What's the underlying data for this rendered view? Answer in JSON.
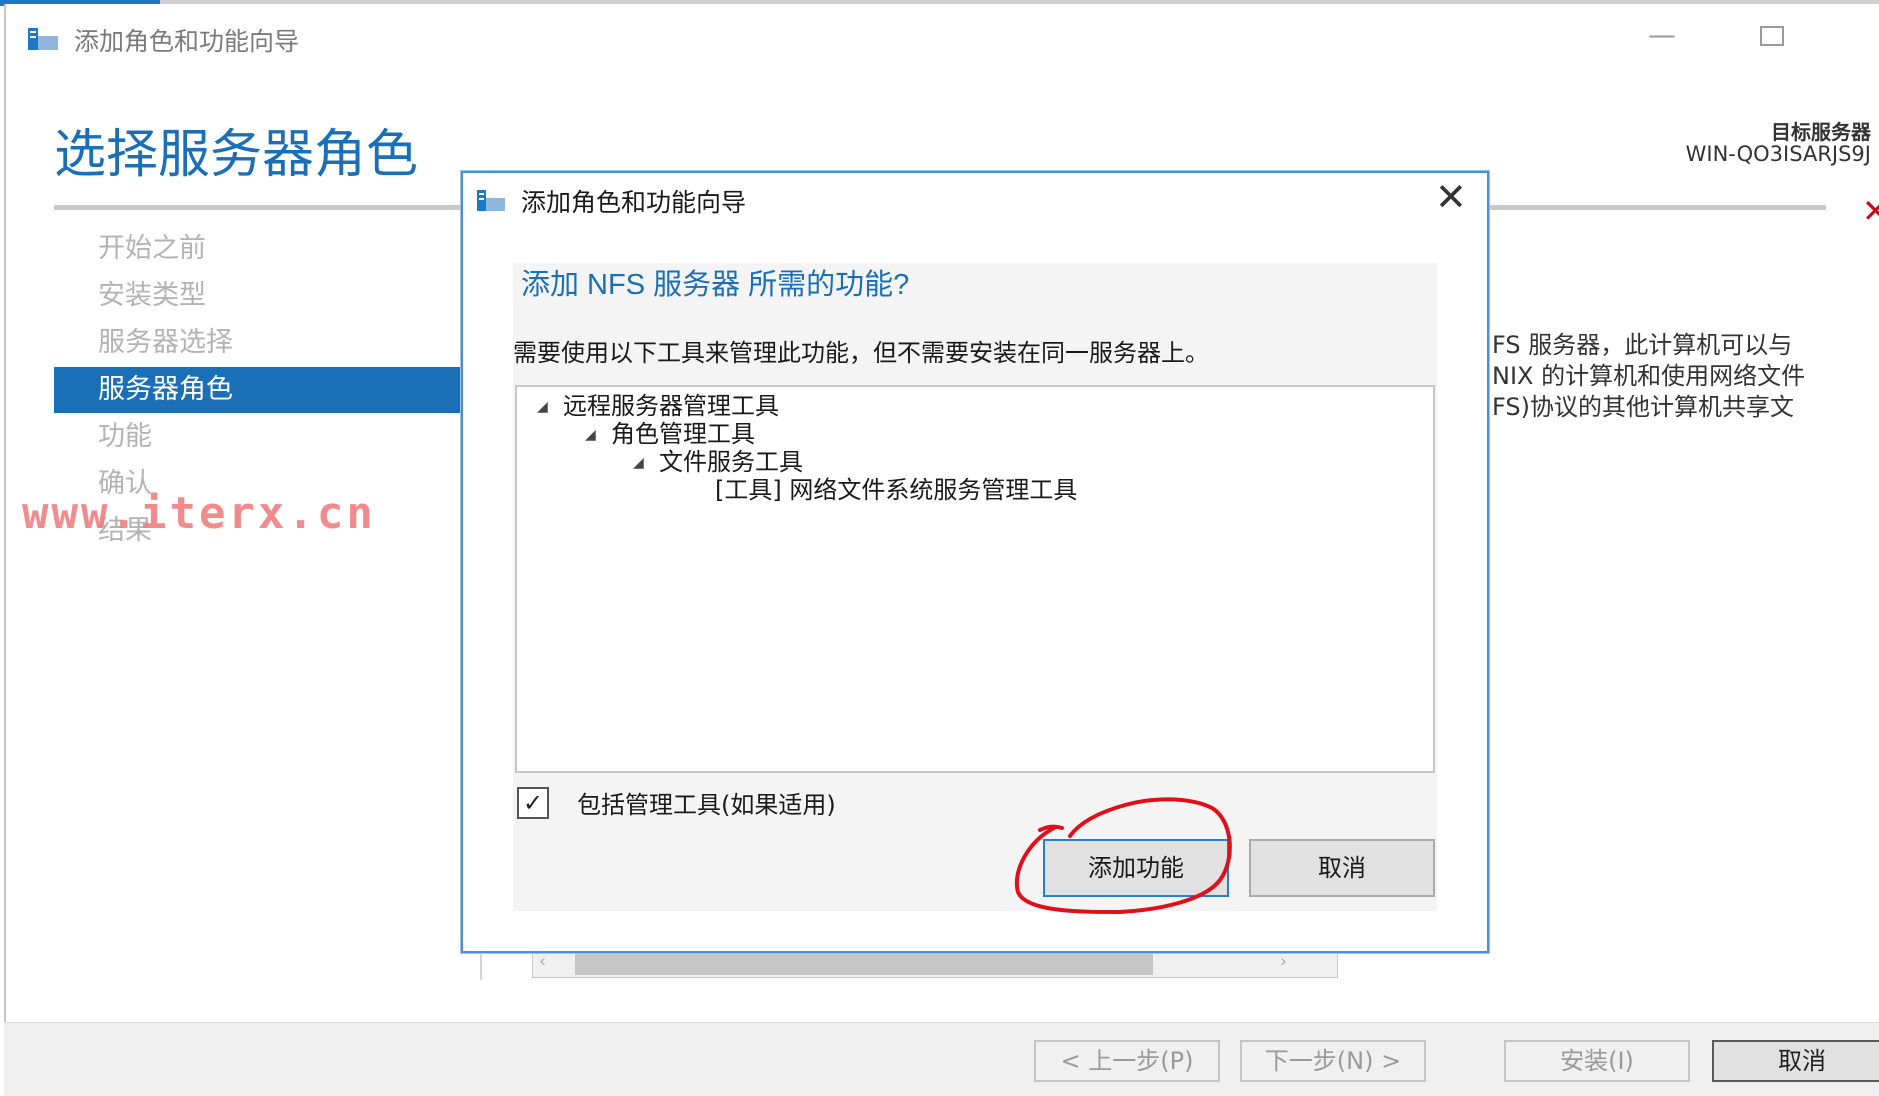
{
  "main_window": {
    "title": "添加角色和功能向导",
    "page_heading": "选择服务器角色",
    "target_server_label": "目标服务器",
    "target_server_name": "WIN-QO3ISARJS9J",
    "error_icon": "red-x-icon"
  },
  "nav": {
    "items": [
      {
        "label": "开始之前"
      },
      {
        "label": "安装类型"
      },
      {
        "label": "服务器选择"
      },
      {
        "label": "服务器角色"
      },
      {
        "label": "功能"
      },
      {
        "label": "确认"
      },
      {
        "label": "结果"
      }
    ],
    "active_index": 3
  },
  "watermark": "www.iterx.cn",
  "description": {
    "line1": "FS 服务器，此计算机可以与",
    "line2": "NIX 的计算机和使用网络文件",
    "line3": "FS)协议的其他计算机共享文"
  },
  "footer": {
    "prev_label": "< 上一步(P)",
    "next_label": "下一步(N) >",
    "install_label": "安装(I)",
    "cancel_label": "取消"
  },
  "dialog": {
    "title": "添加角色和功能向导",
    "question": "添加 NFS 服务器 所需的功能?",
    "instruction": "需要使用以下工具来管理此功能，但不需要安装在同一服务器上。",
    "tree": [
      {
        "label": "远程服务器管理工具",
        "expanded": true
      },
      {
        "label": "角色管理工具",
        "expanded": true
      },
      {
        "label": "文件服务工具",
        "expanded": true
      },
      {
        "label": "[工具] 网络文件系统服务管理工具",
        "expanded": false
      }
    ],
    "include_tools_label": "包括管理工具(如果适用)",
    "include_tools_checked": true,
    "add_features_label": "添加功能",
    "cancel_label": "取消"
  },
  "colors": {
    "accent": "#1b6fb6",
    "annotation": "#e0101a",
    "watermark": "#f08080"
  }
}
